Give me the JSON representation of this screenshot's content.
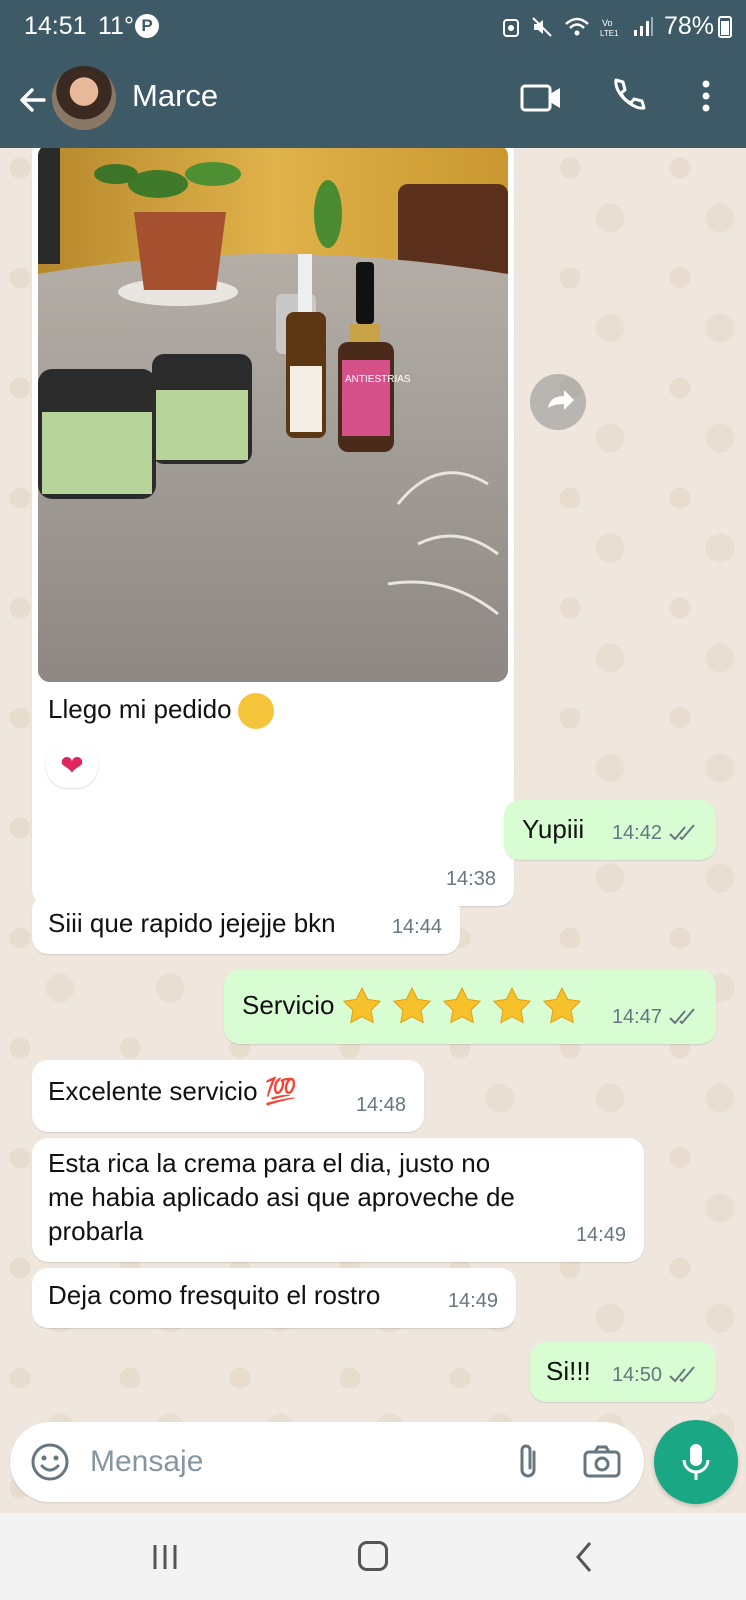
{
  "status_bar": {
    "time": "14:51",
    "temperature": "11°",
    "battery": "78%"
  },
  "header": {
    "contact_name": "Marce"
  },
  "messages": [
    {
      "direction": "in",
      "type": "image",
      "caption": "Llego mi pedido",
      "emoji": "hugging-face",
      "time": "14:38",
      "reaction": "❤"
    },
    {
      "direction": "out",
      "text": "Yupiii",
      "time": "14:42",
      "status": "read"
    },
    {
      "direction": "in",
      "text": "Siii que rapido jejejje bkn",
      "time": "14:44"
    },
    {
      "direction": "out",
      "text": "Servicio",
      "stars": 5,
      "time": "14:47",
      "status": "read"
    },
    {
      "direction": "in",
      "text": "Excelente servicio 💯",
      "time": "14:48"
    },
    {
      "direction": "in",
      "text_lines": [
        "Esta rica la crema para el dia, justo no",
        "me habia aplicado asi que aproveche de",
        "probarla"
      ],
      "time": "14:49"
    },
    {
      "direction": "in",
      "text": "Deja como fresquito el rostro",
      "time": "14:49"
    },
    {
      "direction": "out",
      "text": "Si!!!",
      "time": "14:50",
      "status": "read"
    }
  ],
  "composer": {
    "placeholder": "Mensaje"
  },
  "colors": {
    "header": "#3f5a67",
    "outgoing_bubble": "#d9fdd3",
    "incoming_bubble": "#ffffff",
    "mic_button": "#1aa884",
    "read_ticks": "#667781"
  },
  "icons": [
    "back-arrow-icon",
    "video-call-icon",
    "phone-icon",
    "more-vert-icon",
    "forward-icon",
    "smiley-icon",
    "attach-icon",
    "camera-icon",
    "mic-icon"
  ]
}
